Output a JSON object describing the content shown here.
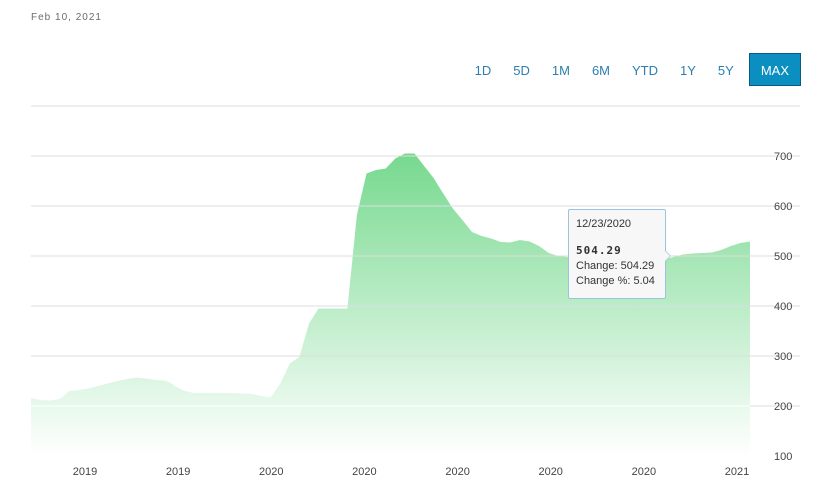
{
  "header": {
    "date": "Feb 10, 2021"
  },
  "range_buttons": [
    {
      "label": "1D",
      "active": false
    },
    {
      "label": "5D",
      "active": false
    },
    {
      "label": "1M",
      "active": false
    },
    {
      "label": "6M",
      "active": false
    },
    {
      "label": "YTD",
      "active": false
    },
    {
      "label": "1Y",
      "active": false
    },
    {
      "label": "5Y",
      "active": false
    },
    {
      "label": "MAX",
      "active": true
    }
  ],
  "tooltip": {
    "date": "12/23/2020",
    "value": "504.29",
    "change": "Change: 504.29",
    "change_pct": "Change %: 5.04"
  },
  "colors": {
    "area_top": "#76d98e",
    "area_bottom": "#ffffff",
    "grid": "#dddddd",
    "active_button": "#0b8ec0",
    "button_text": "#2c7fb0"
  },
  "chart_data": {
    "type": "area",
    "ylim": [
      100,
      800
    ],
    "y_ticks": [
      100,
      200,
      300,
      400,
      500,
      600,
      700
    ],
    "x_tick_labels": [
      "2019",
      "2019",
      "2020",
      "2020",
      "2020",
      "2020",
      "2020",
      "2021"
    ],
    "grid": true,
    "series": [
      {
        "x": [
          0,
          2,
          4,
          6,
          8,
          10,
          12,
          14,
          16,
          18,
          20,
          22,
          24,
          26,
          28,
          29,
          30,
          32,
          34,
          36,
          38,
          40,
          42,
          44,
          46,
          48,
          50,
          52,
          54,
          56,
          58,
          60,
          62,
          64,
          66,
          68,
          70,
          72,
          74,
          76,
          78,
          80,
          82,
          84,
          86,
          88,
          90,
          92,
          94,
          96,
          98,
          100,
          102,
          104,
          106,
          108,
          110,
          112,
          114,
          116,
          118,
          120,
          122,
          124,
          126,
          128,
          130,
          132,
          134,
          136,
          138,
          140,
          142,
          144,
          146,
          148,
          150
        ],
        "values": [
          216,
          212,
          211,
          214,
          230,
          232,
          235,
          240,
          245,
          250,
          254,
          257,
          255,
          252,
          251,
          247,
          240,
          230,
          226,
          226,
          226,
          226,
          226,
          225,
          224,
          220,
          217,
          245,
          285,
          298,
          365,
          395,
          395,
          395,
          395,
          582,
          665,
          672,
          675,
          695,
          705,
          705,
          680,
          656,
          625,
          595,
          572,
          548,
          540,
          535,
          528,
          527,
          532,
          529,
          520,
          506,
          500,
          498,
          497,
          498,
          498,
          498,
          494,
          491,
          489,
          492,
          502,
          493,
          498,
          503,
          505,
          506,
          507,
          512,
          520,
          526,
          529
        ]
      }
    ]
  }
}
